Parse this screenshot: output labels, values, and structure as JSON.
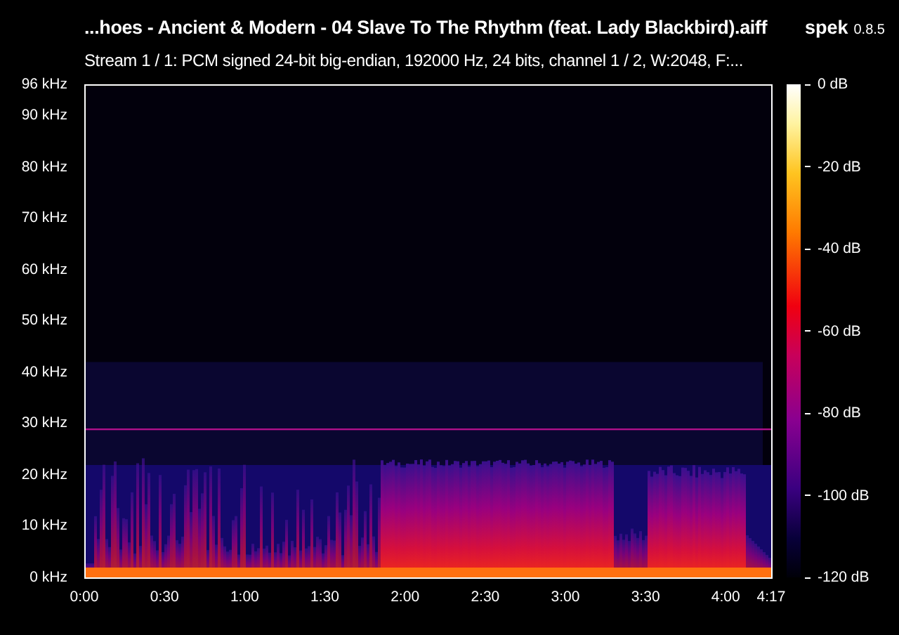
{
  "title": "...hoes - Ancient & Modern - 04 Slave To The Rhythm (feat. Lady Blackbird).aiff",
  "app": {
    "name": "spek",
    "version": "0.8.5"
  },
  "stream_info": "Stream 1 / 1: PCM signed 24-bit big-endian, 192000 Hz, 24 bits, channel 1 / 2, W:2048, F:...",
  "frequency_axis": {
    "ticks": [
      "96 kHz",
      "90 kHz",
      "80 kHz",
      "70 kHz",
      "60 kHz",
      "50 kHz",
      "40 kHz",
      "30 kHz",
      "20 kHz",
      "10 kHz",
      "0 kHz"
    ]
  },
  "time_axis": {
    "ticks": [
      "0:00",
      "0:30",
      "1:00",
      "1:30",
      "2:00",
      "2:30",
      "3:00",
      "3:30",
      "4:00",
      "4:17"
    ]
  },
  "color_scale": {
    "ticks": [
      "0 dB",
      "-20 dB",
      "-40 dB",
      "-60 dB",
      "-80 dB",
      "-100 dB",
      "-120 dB"
    ]
  }
}
